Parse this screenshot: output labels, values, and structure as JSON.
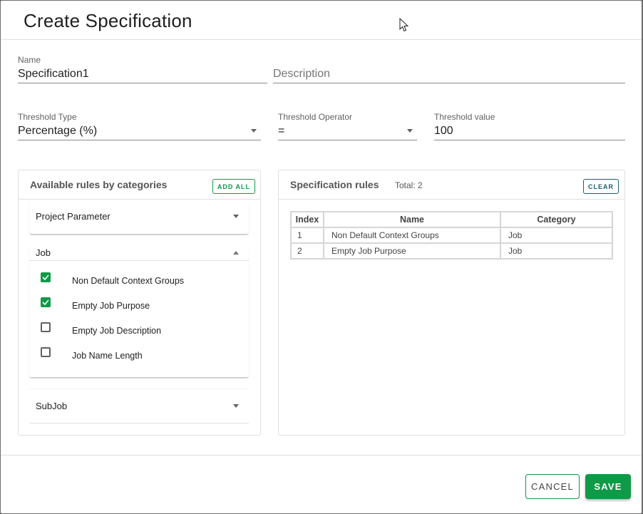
{
  "dialog": {
    "title": "Create Specification"
  },
  "form": {
    "name": {
      "label": "Name",
      "value": "Specification1"
    },
    "description": {
      "placeholder": "Description",
      "value": ""
    },
    "threshold_type": {
      "label": "Threshold Type",
      "value": "Percentage (%)"
    },
    "threshold_operator": {
      "label": "Threshold Operator",
      "value": "="
    },
    "threshold_value": {
      "label": "Threshold value",
      "value": "100"
    }
  },
  "available_rules": {
    "title": "Available rules by categories",
    "add_all_label": "ADD ALL",
    "categories": [
      {
        "label": "Project Parameter",
        "expanded": false,
        "rules": []
      },
      {
        "label": "Job",
        "expanded": true,
        "rules": [
          {
            "label": "Non Default Context Groups",
            "checked": true
          },
          {
            "label": "Empty Job Purpose",
            "checked": true
          },
          {
            "label": "Empty Job Description",
            "checked": false
          },
          {
            "label": "Job Name Length",
            "checked": false
          }
        ]
      },
      {
        "label": "SubJob",
        "expanded": false,
        "rules": []
      }
    ]
  },
  "specification_rules": {
    "title": "Specification rules",
    "total_label": "Total: 2",
    "clear_label": "CLEAR",
    "columns": [
      "Index",
      "Name",
      "Category"
    ],
    "rows": [
      {
        "index": "1",
        "name": "Non Default Context Groups",
        "category": "Job"
      },
      {
        "index": "2",
        "name": "Empty Job Purpose",
        "category": "Job"
      }
    ]
  },
  "footer": {
    "cancel_label": "CANCEL",
    "save_label": "SAVE"
  },
  "colors": {
    "primary_green": "#0f9a48",
    "clear_teal": "#1d5e6e"
  }
}
